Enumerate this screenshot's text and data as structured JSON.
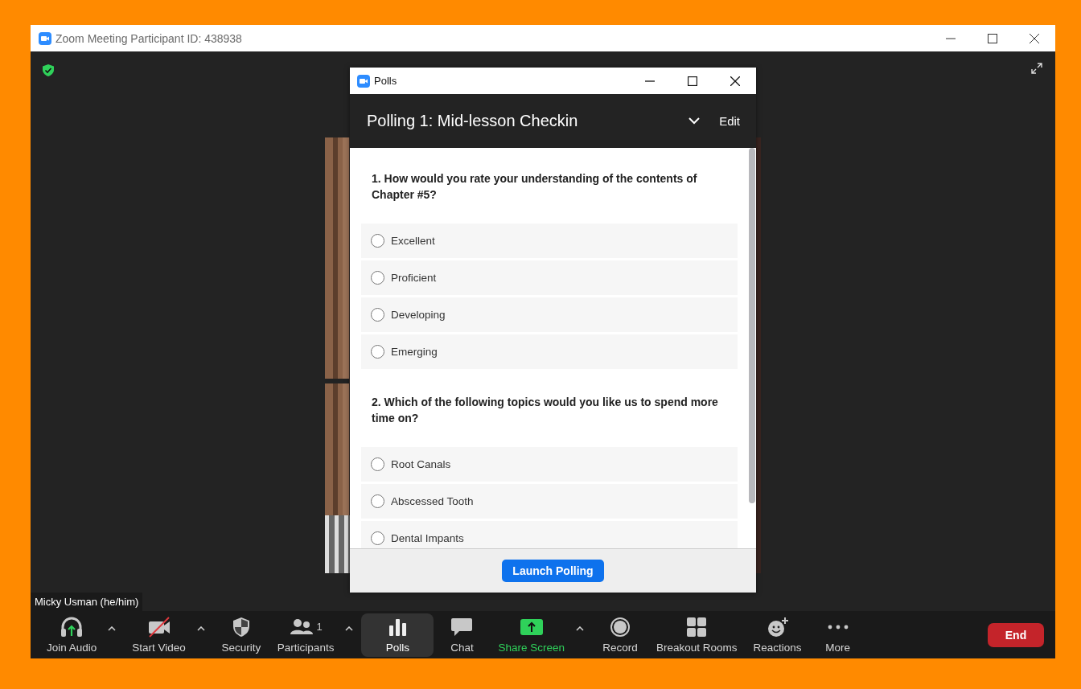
{
  "window": {
    "title": "Zoom Meeting Participant ID: 438938"
  },
  "meeting": {
    "name_tag": "Micky Usman (he/him)"
  },
  "poll_window": {
    "title": "Polls",
    "poll_title": "Polling 1: Mid-lesson Checkin",
    "edit": "Edit",
    "questions": [
      {
        "text": "1. How would you rate your understanding of the contents of Chapter #5?",
        "options": [
          {
            "label": "Excellent",
            "selected": false
          },
          {
            "label": "Proficient",
            "selected": false
          },
          {
            "label": "Developing",
            "selected": false
          },
          {
            "label": "Emerging",
            "selected": false
          }
        ]
      },
      {
        "text": "2. Which of the following topics would you like us to spend more time on?",
        "options": [
          {
            "label": "Root Canals",
            "selected": false
          },
          {
            "label": "Abscessed Tooth",
            "selected": false
          },
          {
            "label": "Dental Impants",
            "selected": false
          }
        ]
      }
    ],
    "launch_button": "Launch Polling"
  },
  "toolbar": {
    "items": [
      {
        "kind": "audio",
        "label": "Join Audio",
        "caret": true,
        "selected": false
      },
      {
        "kind": "video",
        "label": "Start Video",
        "caret": true,
        "selected": false
      },
      {
        "kind": "security",
        "label": "Security",
        "caret": false,
        "selected": false
      },
      {
        "kind": "participants",
        "label": "Participants",
        "count": "1",
        "caret": true,
        "selected": false
      },
      {
        "kind": "polls",
        "label": "Polls",
        "caret": false,
        "selected": true
      },
      {
        "kind": "chat",
        "label": "Chat",
        "caret": false,
        "selected": false
      },
      {
        "kind": "share",
        "label": "Share Screen",
        "caret": true,
        "selected": false
      },
      {
        "kind": "record",
        "label": "Record",
        "caret": false,
        "selected": false
      },
      {
        "kind": "breakout",
        "label": "Breakout Rooms",
        "caret": false,
        "selected": false
      },
      {
        "kind": "reactions",
        "label": "Reactions",
        "caret": false,
        "selected": false
      },
      {
        "kind": "more",
        "label": "More",
        "caret": false,
        "selected": false
      }
    ],
    "end_button": "End"
  }
}
